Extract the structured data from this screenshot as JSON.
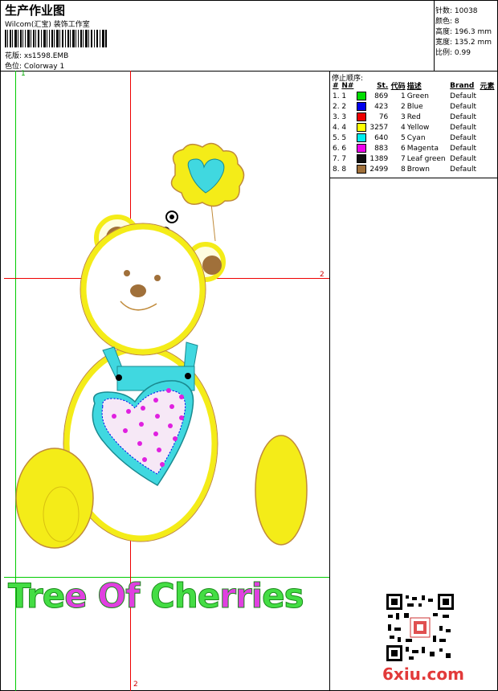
{
  "header": {
    "title": "生产作业图",
    "company": "Wilcom(汇宝) 装饰工作室",
    "design_label": "花版:",
    "design_value": "xs1598.EMB",
    "colorway_label": "色位:",
    "colorway_value": "Colorway 1"
  },
  "stats": {
    "stitches": "针数: 10038",
    "colors": "颜色: 8",
    "height": "高度: 196.3 mm",
    "width": "宽度: 135.2 mm",
    "scale": "比例: 0.99"
  },
  "stop_sequence": {
    "title": "停止顺序:",
    "headers": [
      "#",
      "N#",
      "St.",
      "代码",
      "描述",
      "Brand",
      "元素"
    ],
    "rows": [
      {
        "idx": "1.",
        "n": "1",
        "color": "#00dd00",
        "st": "869",
        "code": "1",
        "desc": "Green",
        "brand": "Default"
      },
      {
        "idx": "2.",
        "n": "2",
        "color": "#0000ee",
        "st": "423",
        "code": "2",
        "desc": "Blue",
        "brand": "Default"
      },
      {
        "idx": "3.",
        "n": "3",
        "color": "#ee0000",
        "st": "76",
        "code": "3",
        "desc": "Red",
        "brand": "Default"
      },
      {
        "idx": "4.",
        "n": "4",
        "color": "#ffff00",
        "st": "3257",
        "code": "4",
        "desc": "Yellow",
        "brand": "Default"
      },
      {
        "idx": "5.",
        "n": "5",
        "color": "#00eeee",
        "st": "640",
        "code": "5",
        "desc": "Cyan",
        "brand": "Default"
      },
      {
        "idx": "6.",
        "n": "6",
        "color": "#ee00ee",
        "st": "883",
        "code": "6",
        "desc": "Magenta",
        "brand": "Default"
      },
      {
        "idx": "7.",
        "n": "7",
        "color": "#101010",
        "st": "1389",
        "code": "7",
        "desc": "Leaf green",
        "brand": "Default"
      },
      {
        "idx": "8.",
        "n": "8",
        "color": "#a0703a",
        "st": "2499",
        "code": "8",
        "desc": "Brown",
        "brand": "Default"
      }
    ]
  },
  "canvas": {
    "marker_top": "1",
    "marker_right": "2",
    "marker_bottom": "2",
    "design_text": "Tree Of Cherries"
  },
  "watermark": {
    "site": "6xiu.com"
  },
  "colors": {
    "guide_red": "#ee0000",
    "guide_green": "#00cc00",
    "bear_yellow": "#f4ec18",
    "bear_outline": "#c08a3a",
    "cyan": "#40d8e0",
    "magenta": "#e020e0",
    "brown": "#a0703a",
    "text_green": "#44dd44",
    "text_magenta": "#e040e0"
  }
}
